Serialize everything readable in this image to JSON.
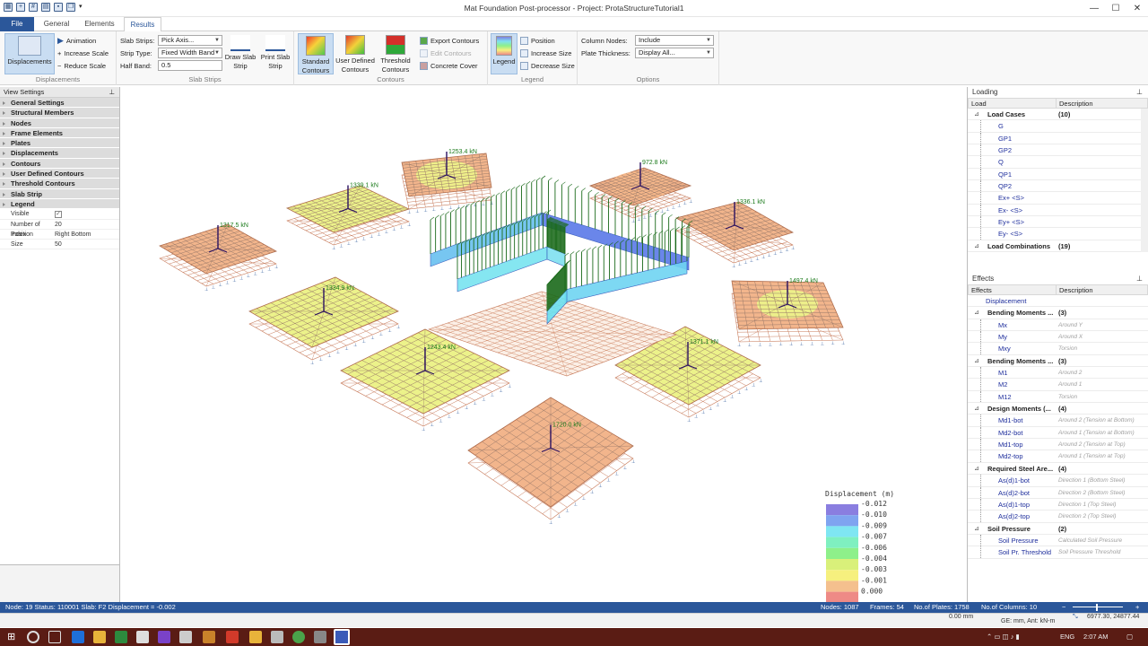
{
  "window": {
    "title": "Mat Foundation Post-processor - Project: ProtaStructureTutorial1",
    "min": "—",
    "max": "☐",
    "close": "✕"
  },
  "tabs": [
    "File",
    "General",
    "Elements",
    "Results"
  ],
  "ribbon": {
    "displacements": {
      "button": "Displacements",
      "animation": "Animation",
      "increase": "Increase Scale",
      "reduce": "Reduce Scale",
      "group": "Displacements"
    },
    "slab": {
      "strips_label": "Slab Strips:",
      "strips_value": "Pick Axis...",
      "type_label": "Strip Type:",
      "type_value": "Fixed Width Band",
      "half_label": "Half Band:",
      "half_value": "0.5",
      "draw": "Draw Slab Strip",
      "print": "Print Slab Strip",
      "group": "Slab Strips"
    },
    "contours": {
      "standard": "Standard Contours",
      "user": "User Defined Contours",
      "threshold": "Threshold Contours",
      "export": "Export Contours",
      "edit": "Edit Contours",
      "concrete": "Concrete Cover",
      "group": "Contours"
    },
    "legend": {
      "button": "Legend",
      "position": "Position",
      "increase": "Increase Size",
      "decrease": "Decrease Size",
      "group": "Legend"
    },
    "options": {
      "nodes_label": "Column Nodes:",
      "nodes_value": "Include",
      "thick_label": "Plate Thickness:",
      "thick_value": "Display All...",
      "group": "Options"
    }
  },
  "view_settings": {
    "title": "View Settings",
    "sections": [
      "General Settings",
      "Structural Members",
      "Nodes",
      "Frame Elements",
      "Plates",
      "Displacements",
      "Contours",
      "User Defined Contours",
      "Threshold Contours",
      "Slab Strip",
      "Legend"
    ],
    "legend_props": [
      {
        "k": "Visible",
        "v": ""
      },
      {
        "k": "Number of Index",
        "v": "20"
      },
      {
        "k": "Position",
        "v": "Right Bottom"
      },
      {
        "k": "Size",
        "v": "50"
      }
    ]
  },
  "loading": {
    "title": "Loading",
    "col_load": "Load",
    "col_desc": "Description",
    "rows": [
      {
        "t": "cat",
        "name": "Load Cases",
        "desc": "(10)"
      },
      {
        "t": "leaf",
        "name": "G",
        "desc": ""
      },
      {
        "t": "leaf",
        "name": "GP1",
        "desc": ""
      },
      {
        "t": "leaf",
        "name": "GP2",
        "desc": ""
      },
      {
        "t": "leaf",
        "name": "Q",
        "desc": ""
      },
      {
        "t": "leaf",
        "name": "QP1",
        "desc": ""
      },
      {
        "t": "leaf",
        "name": "QP2",
        "desc": ""
      },
      {
        "t": "leaf",
        "name": "Ex+ <S>",
        "desc": ""
      },
      {
        "t": "leaf",
        "name": "Ex- <S>",
        "desc": ""
      },
      {
        "t": "leaf",
        "name": "Ey+ <S>",
        "desc": ""
      },
      {
        "t": "leaf",
        "name": "Ey- <S>",
        "desc": ""
      },
      {
        "t": "cat",
        "name": "Load Combinations",
        "desc": "(19)"
      }
    ]
  },
  "effects": {
    "title": "Effects",
    "col_effects": "Effects",
    "col_desc": "Description",
    "rows": [
      {
        "t": "top",
        "name": "Displacement",
        "desc": ""
      },
      {
        "t": "cat",
        "name": "Bending Moments ...",
        "desc": "(3)"
      },
      {
        "t": "leaf",
        "name": "Mx",
        "desc": "Around Y"
      },
      {
        "t": "leaf",
        "name": "My",
        "desc": "Around X"
      },
      {
        "t": "leaf",
        "name": "Mxy",
        "desc": "Torsion"
      },
      {
        "t": "cat",
        "name": "Bending Moments ...",
        "desc": "(3)"
      },
      {
        "t": "leaf",
        "name": "M1",
        "desc": "Around 2"
      },
      {
        "t": "leaf",
        "name": "M2",
        "desc": "Around 1"
      },
      {
        "t": "leaf",
        "name": "M12",
        "desc": "Torsion"
      },
      {
        "t": "cat",
        "name": "Design Moments (...",
        "desc": "(4)"
      },
      {
        "t": "leaf",
        "name": "Md1-bot",
        "desc": "Around 2 (Tension at Bottom)"
      },
      {
        "t": "leaf",
        "name": "Md2-bot",
        "desc": "Around 1 (Tension at Bottom)"
      },
      {
        "t": "leaf",
        "name": "Md1-top",
        "desc": "Around 2 (Tension at Top)"
      },
      {
        "t": "leaf",
        "name": "Md2-top",
        "desc": "Around 1 (Tension at Top)"
      },
      {
        "t": "cat",
        "name": "Required Steel Are...",
        "desc": "(4)"
      },
      {
        "t": "leaf",
        "name": "As(d)1-bot",
        "desc": "Direction 1 (Bottom Steel)"
      },
      {
        "t": "leaf",
        "name": "As(d)2-bot",
        "desc": "Direction 2 (Bottom Steel)"
      },
      {
        "t": "leaf",
        "name": "As(d)1-top",
        "desc": "Direction 1 (Top Steel)"
      },
      {
        "t": "leaf",
        "name": "As(d)2-top",
        "desc": "Direction 2 (Top Steel)"
      },
      {
        "t": "cat",
        "name": "Soil Pressure",
        "desc": "(2)"
      },
      {
        "t": "leaf",
        "name": "Soil Pressure",
        "desc": "Calculated Soil Pressure"
      },
      {
        "t": "leaf",
        "name": "Soil Pr. Threshold",
        "desc": "Soil Pressure Threshold"
      }
    ]
  },
  "legend_box": {
    "title": "Displacement (m)",
    "labels": [
      "-0.012",
      "-0.010",
      "-0.009",
      "-0.007",
      "-0.006",
      "-0.004",
      "-0.003",
      "-0.001",
      "0.000"
    ],
    "colors": [
      "#8a7ee0",
      "#7fa4f0",
      "#7fe6f2",
      "#7ff0c0",
      "#8ef08a",
      "#d9f07a",
      "#f6f07e",
      "#f4c08e",
      "#ee8a86"
    ]
  },
  "footings": [
    {
      "label": "1253.4 kN",
      "color": "#f2b58c",
      "top": "#eef28a"
    },
    {
      "label": "972.8 kN",
      "color": "#f0b088",
      "top": "#f4b78a"
    },
    {
      "label": "1339.1 kN",
      "color": "#ecf28a",
      "top": "#ecf28a"
    },
    {
      "label": "1336.1 kN",
      "color": "#f2b58c",
      "top": "#f2b58c"
    },
    {
      "label": "1317.5 kN",
      "color": "#f2b58c",
      "top": "#f2b58c"
    },
    {
      "label": "1334.9 kN",
      "color": "#ecf28a",
      "top": "#ecf28a"
    },
    {
      "label": "1497.4 kN",
      "color": "#f2b58c",
      "top": "#ecf28a"
    },
    {
      "label": "1243.4 kN",
      "color": "#ecf28a",
      "top": "#ecf28a"
    },
    {
      "label": "1371.1 kN",
      "color": "#ecf28a",
      "top": "#ecf28a"
    },
    {
      "label": "1720.0 kN",
      "color": "#f2b58c",
      "top": "#f2b58c"
    }
  ],
  "status": {
    "left": "Node: 19  Status: 110001  Slab: F2  Displacement = -0.002",
    "nodes": "Nodes: 1087",
    "frames": "Frames: 54",
    "plates": "No.of Plates: 1758",
    "columns": "No.of Columns: 10",
    "zoom_minus": "−",
    "zoom_plus": "+",
    "coord0": "0.00 mm",
    "units": "GE: mm, Ant: kN-m",
    "coords": "6977.30, 24877.44"
  },
  "taskbar": {
    "lang": "ENG",
    "time": "2:07 AM"
  }
}
